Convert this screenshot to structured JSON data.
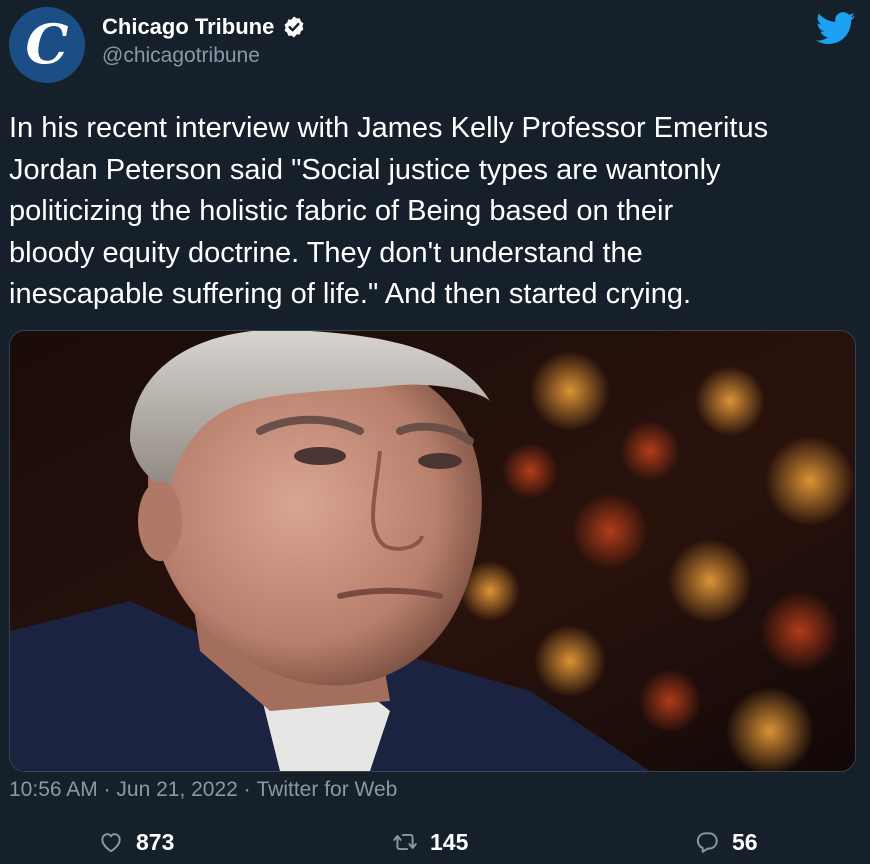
{
  "account": {
    "display_name": "Chicago Tribune",
    "handle": "@chicagotribune",
    "avatar_letter": "C",
    "verified": true
  },
  "tweet": {
    "text": "In his recent interview with James Kelly Professor Emeritus\nJordan Peterson said \"Social justice types are wantonly\npoliticizing the holistic fabric of Being based on their\nbloody equity doctrine. They don't understand the\ninescapable suffering of life.\" And then started crying."
  },
  "meta": {
    "time": "10:56 AM",
    "separator": " · ",
    "date": "Jun 21, 2022",
    "source": "Twitter for Web"
  },
  "actions": {
    "likes": "873",
    "retweets": "145",
    "replies": "56"
  },
  "icons": {
    "verified": "verified-badge-icon",
    "brand": "twitter-bird-icon",
    "like": "heart-icon",
    "retweet": "retweet-icon",
    "reply": "reply-bubble-icon"
  },
  "colors": {
    "background": "#15202b",
    "secondary_text": "#8899a6",
    "twitter_blue": "#1da1f2",
    "avatar_bg": "#1c4e86"
  }
}
